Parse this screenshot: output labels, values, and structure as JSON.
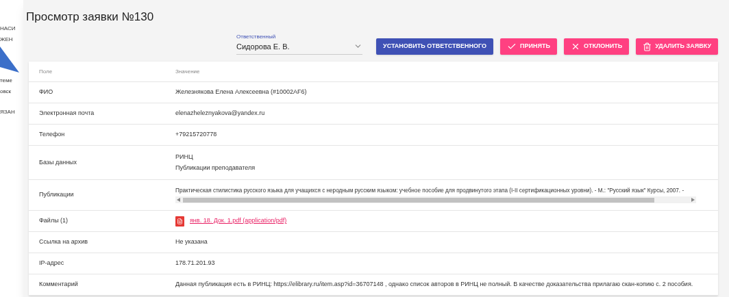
{
  "background_fragments": [
    "НАСИ",
    "ЖЕН",
    "теме",
    "овск",
    "ЯЗАН"
  ],
  "dialog": {
    "title": "Просмотр заявки №130",
    "responsible": {
      "label": "Ответственный",
      "value": "Сидорова Е. В."
    },
    "buttons": [
      {
        "kind": "assign",
        "label": "УСТАНОВИТЬ ОТВЕТСТВЕННОГО"
      },
      {
        "kind": "accept",
        "label": "ПРИНЯТЬ"
      },
      {
        "kind": "reject",
        "label": "ОТКЛОНИТЬ"
      },
      {
        "kind": "delete",
        "label": "УДАЛИТЬ ЗАЯВКУ"
      }
    ],
    "table": {
      "columns": [
        "Поле",
        "Значение"
      ],
      "rows": [
        {
          "kind": "text",
          "field": "ФИО",
          "values": [
            "Железнякова Елена Алексеевна (#10002AF6)"
          ]
        },
        {
          "kind": "text",
          "field": "Электронная почта",
          "values": [
            "elenazheleznyakova@yandex.ru"
          ]
        },
        {
          "kind": "text",
          "field": "Телефон",
          "values": [
            "+79215720778"
          ]
        },
        {
          "kind": "text",
          "field": "Базы данных",
          "values": [
            "РИНЦ",
            "Публикации преподавателя"
          ]
        },
        {
          "kind": "scroll",
          "field": "Публикации",
          "values": [
            "Практическая стилистика русского языка для учащихся с неродным русским языком: учебное пособие для продвинутого этапа (I-II сертификационных уровни). - М.: \"Русский язык\" Курсы, 2007. -"
          ]
        },
        {
          "kind": "file",
          "field": "Файлы (1)",
          "values": [
            "янв. 18. Док. 1.pdf (application/pdf)"
          ]
        },
        {
          "kind": "text",
          "field": "Ссылка на архив",
          "values": [
            "Не указана"
          ]
        },
        {
          "kind": "text",
          "field": "IP-адрес",
          "values": [
            "178.71.201.93"
          ]
        },
        {
          "kind": "text",
          "field": "Комментарий",
          "values": [
            "Данная публикация есть в РИНЦ: https://elibrary.ru/item.asp?id=36707148 , однако список авторов в РИНЦ не полный. В качестве доказательства прилагаю скан-копию с. 2 пособия."
          ]
        }
      ]
    }
  }
}
